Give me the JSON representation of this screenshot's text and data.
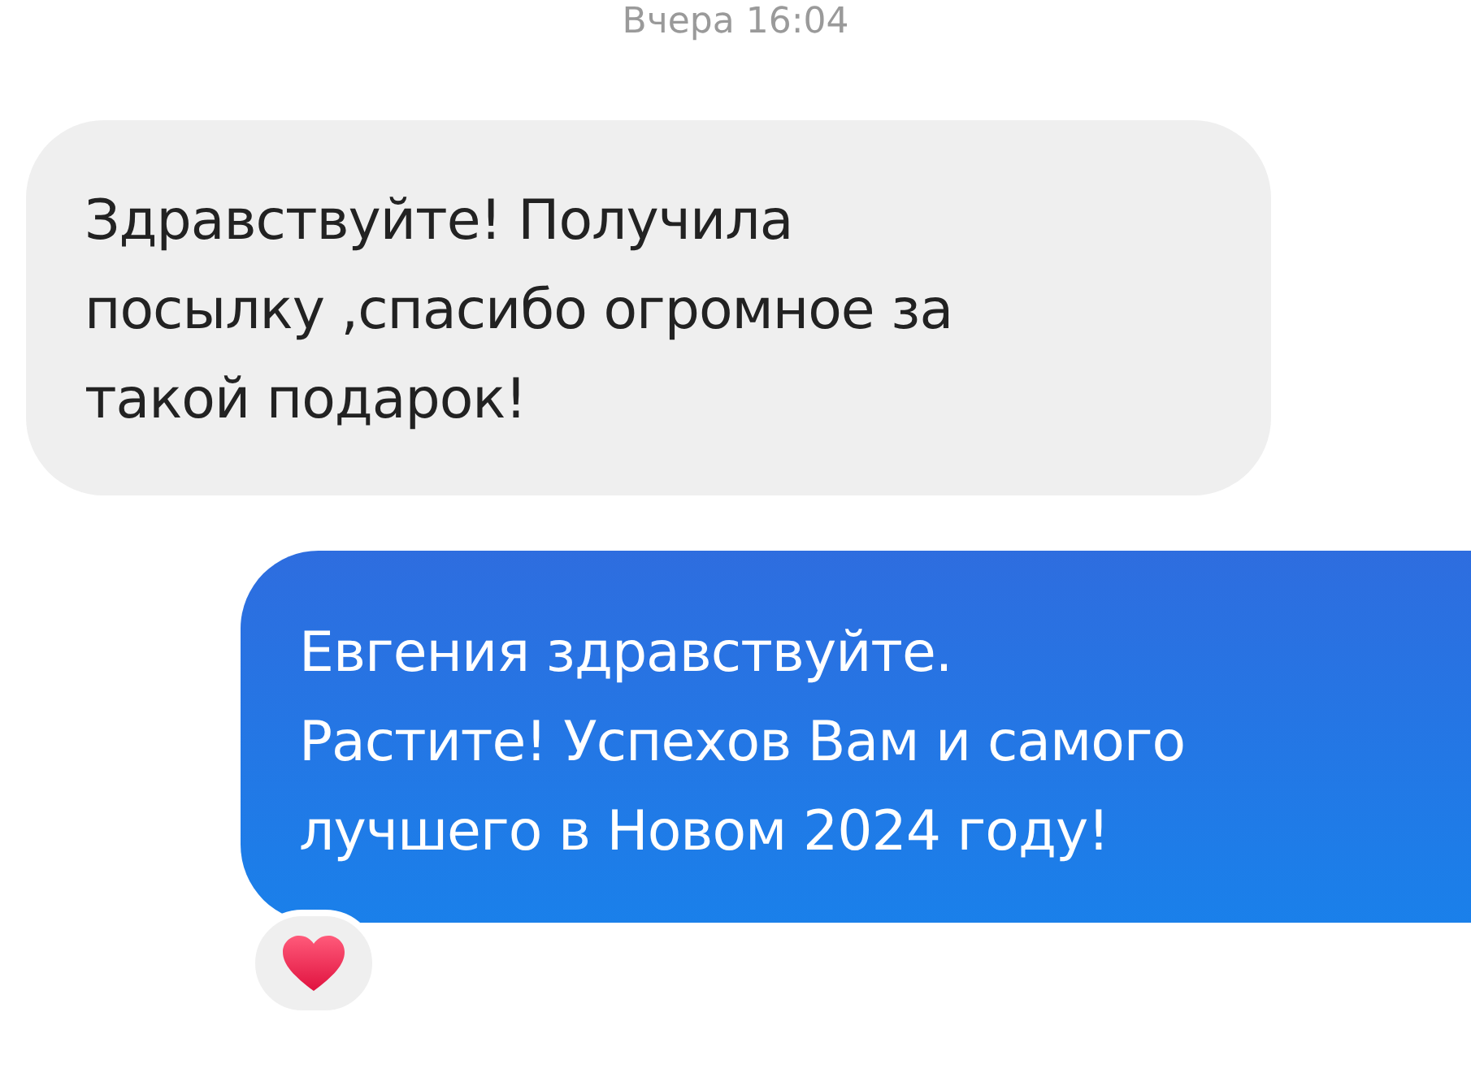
{
  "timestamp": "Вчера 16:04",
  "messages": [
    {
      "kind": "incoming",
      "text": "Здравствуйте! Получила посылку ,спасибо огромное за такой подарок!"
    },
    {
      "kind": "outgoing",
      "text": "Евгения здравствуйте. Растите! Успехов Вам и самого лучшего в Новом 2024 году!",
      "reaction": {
        "kind": "heart"
      }
    }
  ]
}
